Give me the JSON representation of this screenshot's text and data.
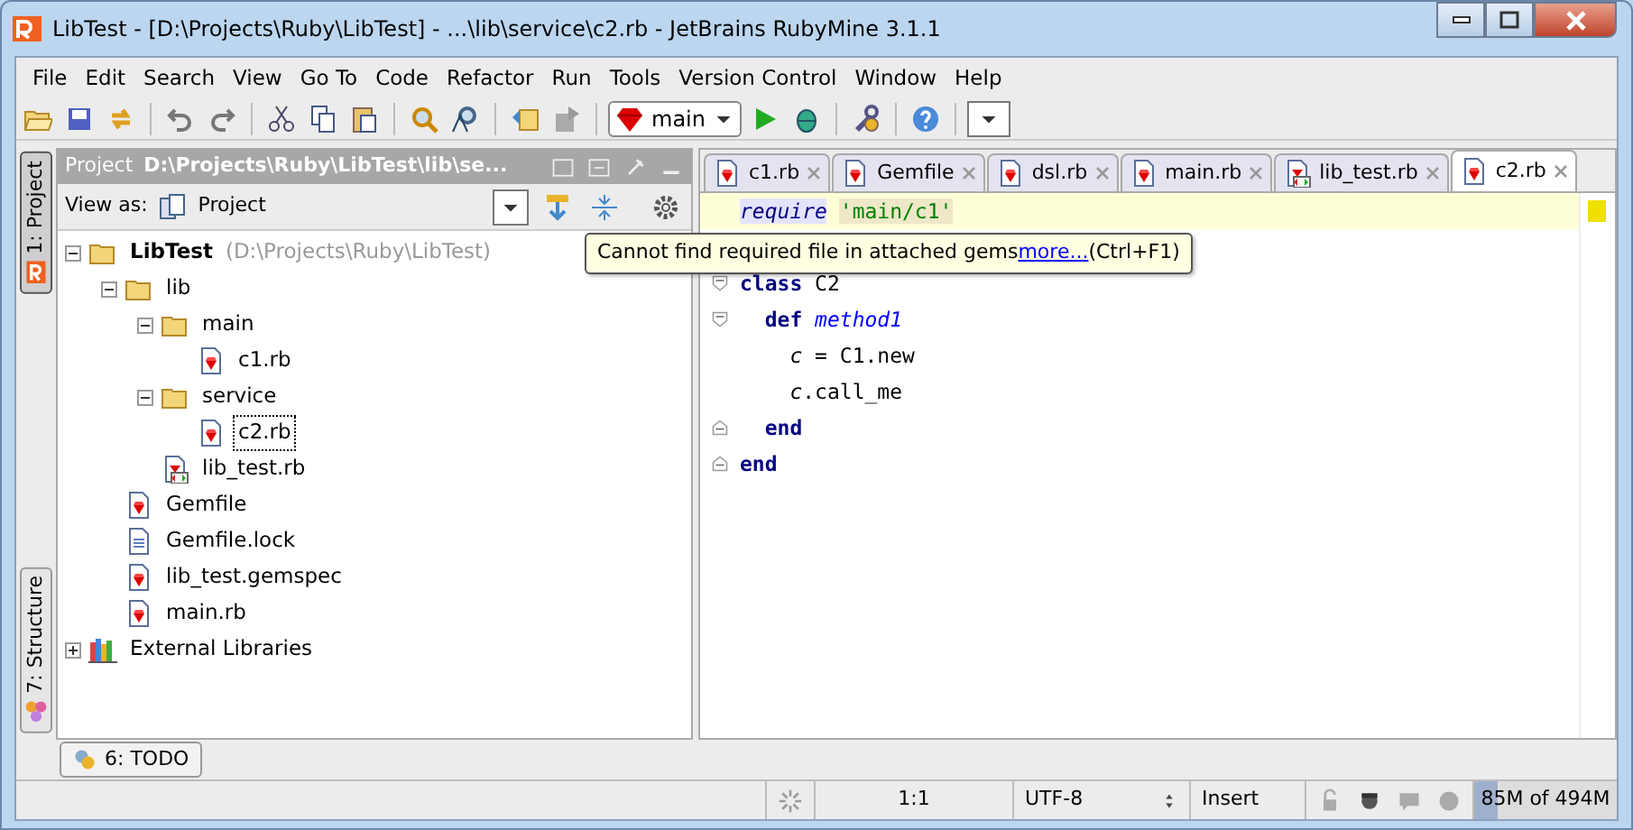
{
  "window": {
    "title": "LibTest - [D:\\Projects\\Ruby\\LibTest] - ...\\lib\\service\\c2.rb - JetBrains RubyMine 3.1.1"
  },
  "menu": [
    "File",
    "Edit",
    "Search",
    "View",
    "Go To",
    "Code",
    "Refactor",
    "Run",
    "Tools",
    "Version Control",
    "Window",
    "Help"
  ],
  "toolbar": {
    "run_config": "main"
  },
  "side_tabs": [
    {
      "label": "1: Project",
      "selected": true,
      "kind": "project"
    },
    {
      "label": "7: Structure",
      "selected": false,
      "kind": "structure"
    }
  ],
  "project_panel": {
    "title": "Project",
    "path": "D:\\Projects\\Ruby\\LibTest\\lib\\se...",
    "view_as_label": "View as:",
    "view_as": "Project",
    "tree": [
      {
        "label": "LibTest",
        "path": "(D:\\Projects\\Ruby\\LibTest)",
        "kind": "folder",
        "expanded": true,
        "selected": false,
        "children": [
          {
            "label": "lib",
            "kind": "folder",
            "expanded": true,
            "selected": false,
            "children": [
              {
                "label": "main",
                "kind": "folder",
                "expanded": true,
                "selected": false,
                "children": [
                  {
                    "label": "c1.rb",
                    "kind": "ruby",
                    "selected": false
                  }
                ]
              },
              {
                "label": "service",
                "kind": "folder",
                "expanded": true,
                "selected": false,
                "children": [
                  {
                    "label": "c2.rb",
                    "kind": "ruby",
                    "selected": true
                  }
                ]
              },
              {
                "label": "lib_test.rb",
                "kind": "test",
                "selected": false
              }
            ]
          },
          {
            "label": "Gemfile",
            "kind": "ruby",
            "selected": false
          },
          {
            "label": "Gemfile.lock",
            "kind": "text",
            "selected": false
          },
          {
            "label": "lib_test.gemspec",
            "kind": "ruby",
            "selected": false
          },
          {
            "label": "main.rb",
            "kind": "ruby",
            "selected": false
          }
        ]
      },
      {
        "label": "External Libraries",
        "kind": "libraries",
        "expanded": false,
        "selected": false
      }
    ]
  },
  "editor_tabs": [
    {
      "label": "c1.rb",
      "kind": "ruby",
      "selected": false
    },
    {
      "label": "Gemfile",
      "kind": "ruby",
      "selected": false
    },
    {
      "label": "dsl.rb",
      "kind": "ruby",
      "selected": false
    },
    {
      "label": "main.rb",
      "kind": "ruby",
      "selected": false
    },
    {
      "label": "lib_test.rb",
      "kind": "test",
      "selected": false
    },
    {
      "label": "c2.rb",
      "kind": "ruby",
      "selected": true
    }
  ],
  "code": [
    {
      "fold_start": false,
      "fold_end": false,
      "highlight": true,
      "tokens": [
        {
          "kind": "require",
          "text": "require"
        },
        {
          "kind": "string",
          "text": "'main/c1'"
        }
      ]
    },
    {
      "highlight": false
    },
    {
      "fold_start": true,
      "fold_end": false,
      "highlight": false,
      "tokens": [
        {
          "kind": "keyword",
          "text": "class"
        },
        {
          "kind": "plain",
          "text": " C2"
        }
      ]
    },
    {
      "fold_start": true,
      "fold_end": false,
      "highlight": false,
      "tokens": [
        {
          "kind": "keyword",
          "text": "  def"
        },
        {
          "kind": "method",
          "text": "method1"
        }
      ]
    },
    {
      "fold_start": false,
      "fold_end": false,
      "highlight": false,
      "tokens": [
        {
          "kind": "var",
          "text": "    c"
        },
        {
          "kind": "plain",
          "text": " = C1.new"
        }
      ]
    },
    {
      "fold_start": false,
      "fold_end": false,
      "highlight": false,
      "tokens": [
        {
          "kind": "var",
          "text": "    c"
        },
        {
          "kind": "plain",
          "text": ".call_me"
        }
      ]
    },
    {
      "fold_start": false,
      "fold_end": true,
      "highlight": false,
      "tokens": [
        {
          "kind": "keyword",
          "text": "  end"
        }
      ]
    },
    {
      "fold_start": false,
      "fold_end": true,
      "highlight": false,
      "tokens": [
        {
          "kind": "keyword",
          "text": "end"
        }
      ]
    }
  ],
  "tooltip": {
    "text": "Cannot find required file in attached gems",
    "link": "more...",
    "shortcut": "(Ctrl+F1)"
  },
  "bottom_tabs": [
    {
      "label": "6: TODO"
    }
  ],
  "status_bar": {
    "position": "1:1",
    "encoding": "UTF-8",
    "mode": "Insert",
    "memory": {
      "text": "85M of 494M",
      "level": 0.17
    }
  }
}
